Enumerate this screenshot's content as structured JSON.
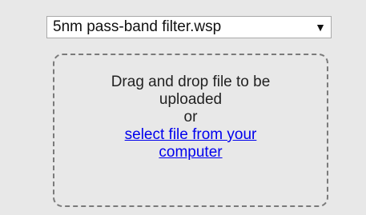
{
  "file_select": {
    "selected": "5nm pass-band filter.wsp",
    "arrow_icon": "dropdown-triangle-icon"
  },
  "dropzone": {
    "instruction": "Drag and drop file to be uploaded",
    "or_text": "or",
    "link_text": "select file from your computer"
  },
  "colors": {
    "background": "#e8e8e8",
    "link": "#0000ee"
  }
}
